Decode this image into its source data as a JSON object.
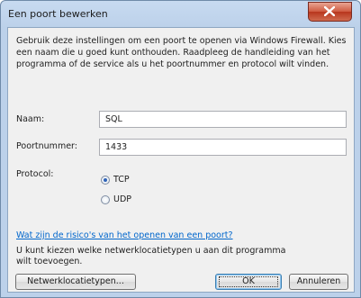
{
  "window": {
    "title": "Een poort bewerken"
  },
  "description": "Gebruik deze instellingen om een poort te openen via Windows Firewall. Kies een naam die u goed kunt onthouden. Raadpleeg de handleiding van het programma of de service als u het poortnummer en protocol wilt vinden.",
  "form": {
    "name_label": "Naam:",
    "name_value": "SQL",
    "port_label": "Poortnummer:",
    "port_value": "1433",
    "protocol_label": "Protocol:",
    "protocol_options": [
      "TCP",
      "UDP"
    ],
    "protocol_selected": "TCP"
  },
  "risk_link": "Wat zijn de risico's van het openen van een poort?",
  "network_info": "U kunt kiezen welke netwerklocatietypen u aan dit programma wilt toevoegen.",
  "buttons": {
    "network_types": "Netwerklocatietypen...",
    "ok": "OK",
    "cancel": "Annuleren"
  }
}
